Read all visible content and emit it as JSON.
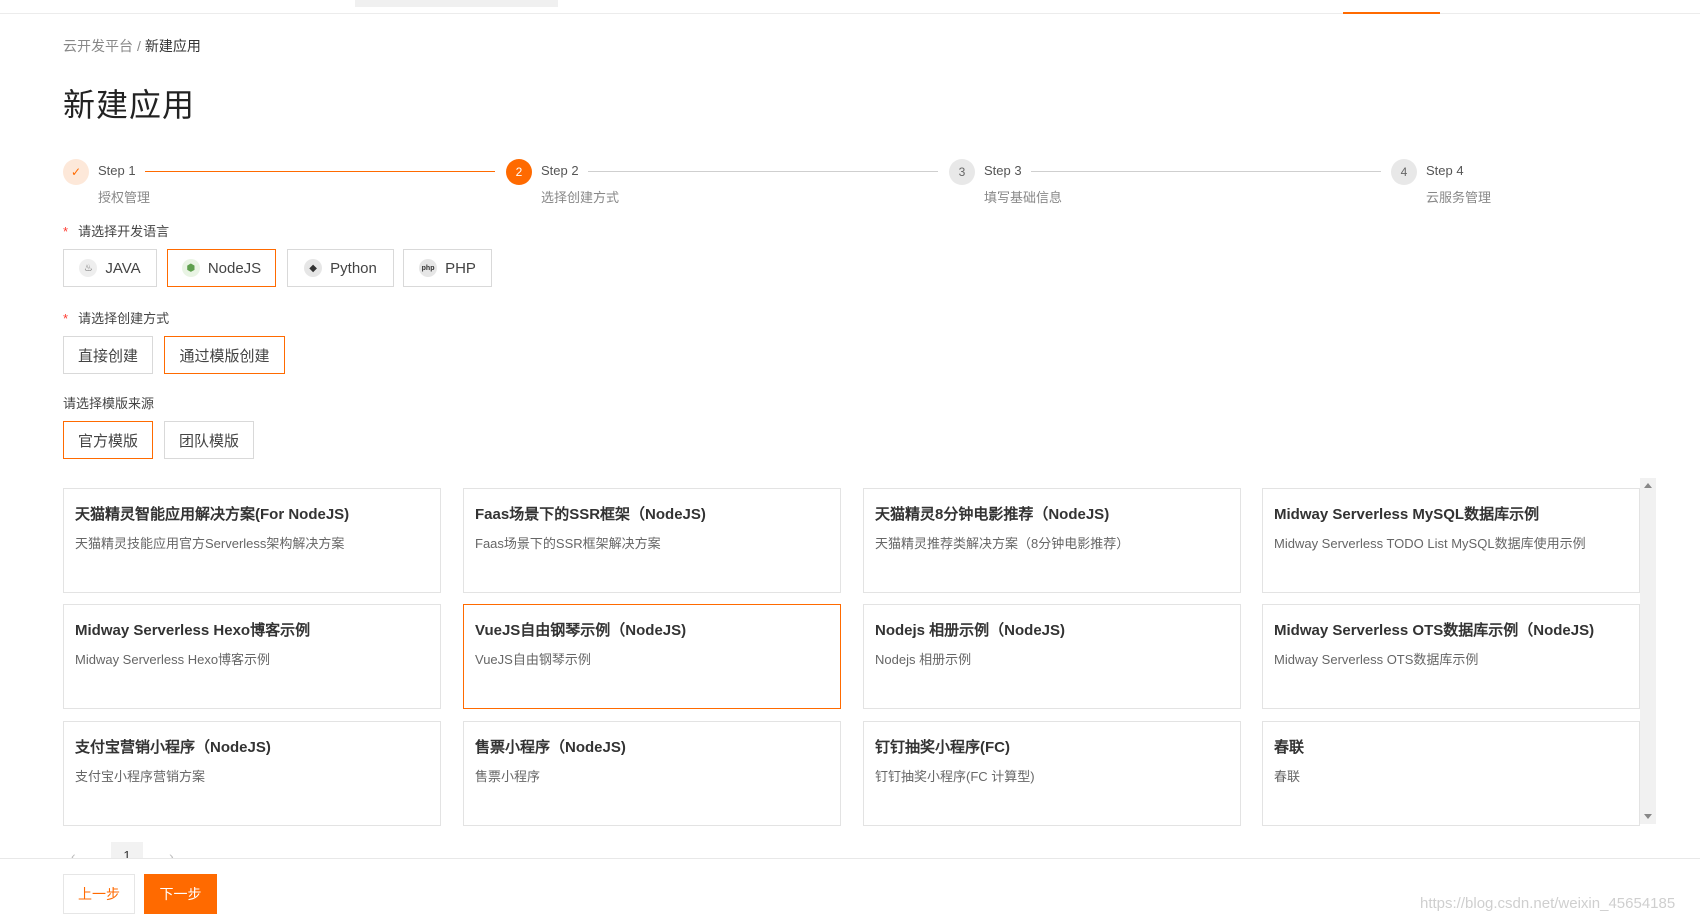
{
  "breadcrumb": {
    "root": "云开发平台",
    "separator": "/",
    "current": "新建应用"
  },
  "page_title": "新建应用",
  "steps": [
    {
      "title": "Step 1",
      "desc": "授权管理",
      "state": "done",
      "marker": "✓"
    },
    {
      "title": "Step 2",
      "desc": "选择创建方式",
      "state": "active",
      "marker": "2"
    },
    {
      "title": "Step 3",
      "desc": "填写基础信息",
      "state": "wait",
      "marker": "3"
    },
    {
      "title": "Step 4",
      "desc": "云服务管理",
      "state": "wait",
      "marker": "4"
    }
  ],
  "language": {
    "label": "请选择开发语言",
    "required_mark": "*",
    "options": [
      {
        "label": "JAVA",
        "icon": "java-icon",
        "glyph": "♨"
      },
      {
        "label": "NodeJS",
        "icon": "nodejs-icon",
        "glyph": "⬢"
      },
      {
        "label": "Python",
        "icon": "python-icon",
        "glyph": "◆"
      },
      {
        "label": "PHP",
        "icon": "php-icon",
        "glyph": "php"
      }
    ],
    "selected": "NodeJS"
  },
  "create_method": {
    "label": "请选择创建方式",
    "required_mark": "*",
    "options": [
      "直接创建",
      "通过模版创建"
    ],
    "selected": "通过模版创建"
  },
  "template_source": {
    "label": "请选择模版来源",
    "options": [
      "官方模版",
      "团队模版"
    ],
    "selected": "官方模版"
  },
  "templates": [
    {
      "title": "天猫精灵智能应用解决方案(For NodeJS)",
      "desc": "天猫精灵技能应用官方Serverless架构解决方案"
    },
    {
      "title": "Faas场景下的SSR框架（NodeJS)",
      "desc": "Faas场景下的SSR框架解决方案"
    },
    {
      "title": "天猫精灵8分钟电影推荐（NodeJS)",
      "desc": "天猫精灵推荐类解决方案（8分钟电影推荐）"
    },
    {
      "title": "Midway Serverless MySQL数据库示例",
      "desc": "Midway Serverless TODO List MySQL数据库使用示例"
    },
    {
      "title": "Midway Serverless Hexo博客示例",
      "desc": "Midway Serverless Hexo博客示例"
    },
    {
      "title": "VueJS自由钢琴示例（NodeJS)",
      "desc": "VueJS自由钢琴示例"
    },
    {
      "title": "Nodejs 相册示例（NodeJS)",
      "desc": "Nodejs 相册示例"
    },
    {
      "title": "Midway Serverless OTS数据库示例（NodeJS)",
      "desc": "Midway Serverless OTS数据库示例"
    },
    {
      "title": "支付宝营销小程序（NodeJS)",
      "desc": "支付宝小程序营销方案"
    },
    {
      "title": "售票小程序（NodeJS)",
      "desc": "售票小程序"
    },
    {
      "title": "钉钉抽奖小程序(FC)",
      "desc": "钉钉抽奖小程序(FC 计算型)"
    },
    {
      "title": "春联",
      "desc": "春联"
    }
  ],
  "selected_template_index": 5,
  "pager": {
    "prev": "‹",
    "page": "1",
    "next": "›"
  },
  "footer": {
    "prev_label": "上一步",
    "next_label": "下一步"
  },
  "watermark": "https://blog.csdn.net/weixin_45654185",
  "colors": {
    "accent": "#ff6a00",
    "border": "#d9d9d9"
  }
}
